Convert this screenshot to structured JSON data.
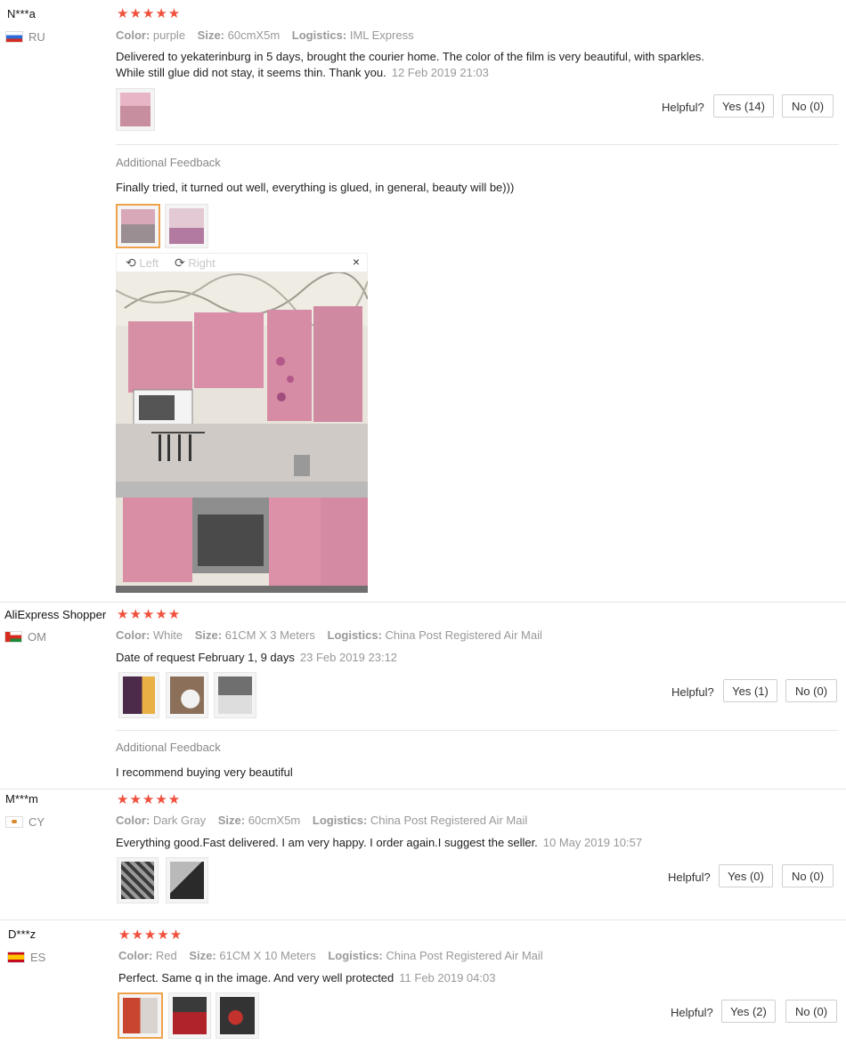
{
  "reviews": [
    {
      "user": "N***a",
      "country": "RU",
      "stars": "★★★★★",
      "color_label": "Color:",
      "color": "purple",
      "size_label": "Size:",
      "size": "60cmX5m",
      "logistics_label": "Logistics:",
      "logistics": "IML Express",
      "text_line1": "Delivered to yekaterinburg in 5 days, brought the courier home. The color of the film is very beautiful, with sparkles.",
      "text_line2": "While still glue did not stay, it seems thin. Thank you.",
      "date": "12 Feb 2019 21:03",
      "helpful_label": "Helpful?",
      "yes_label": "Yes (14)",
      "no_label": "No (0)",
      "additional_title": "Additional Feedback",
      "additional_text": "Finally tried, it turned out well, everything is glued, in general, beauty will be)))"
    },
    {
      "user": "AliExpress Shopper",
      "country": "OM",
      "stars": "★★★★★",
      "color_label": "Color:",
      "color": "White",
      "size_label": "Size:",
      "size": "61CM X 3 Meters",
      "logistics_label": "Logistics:",
      "logistics": "China Post Registered Air Mail",
      "text": "Date of request February 1, 9 days",
      "date": "23 Feb 2019 23:12",
      "helpful_label": "Helpful?",
      "yes_label": "Yes (1)",
      "no_label": "No (0)",
      "additional_title": "Additional Feedback",
      "additional_text": "I recommend buying very beautiful"
    },
    {
      "user": "M***m",
      "country": "CY",
      "stars": "★★★★★",
      "color_label": "Color:",
      "color": "Dark Gray",
      "size_label": "Size:",
      "size": "60cmX5m",
      "logistics_label": "Logistics:",
      "logistics": "China Post Registered Air Mail",
      "text": "Everything good.Fast delivered. I am very happy. I order again.I suggest the seller.",
      "date": "10 May 2019 10:57",
      "helpful_label": "Helpful?",
      "yes_label": "Yes (0)",
      "no_label": "No (0)"
    },
    {
      "user": "D***z",
      "country": "ES",
      "stars": "★★★★★",
      "color_label": "Color:",
      "color": "Red",
      "size_label": "Size:",
      "size": "61CM X 10 Meters",
      "logistics_label": "Logistics:",
      "logistics": "China Post Registered Air Mail",
      "text": "Perfect. Same q in the image. And very well protected",
      "date": "11 Feb 2019 04:03",
      "helpful_label": "Helpful?",
      "yes_label": "Yes (2)",
      "no_label": "No (0)"
    }
  ],
  "viewer": {
    "left_label": "Left",
    "right_label": "Right",
    "close_symbol": "×",
    "rotate_left_icon": "rotate-left-icon",
    "rotate_right_icon": "rotate-right-icon"
  },
  "colors": {
    "stars": "#f0503c",
    "selected_border": "#f0a24a"
  }
}
